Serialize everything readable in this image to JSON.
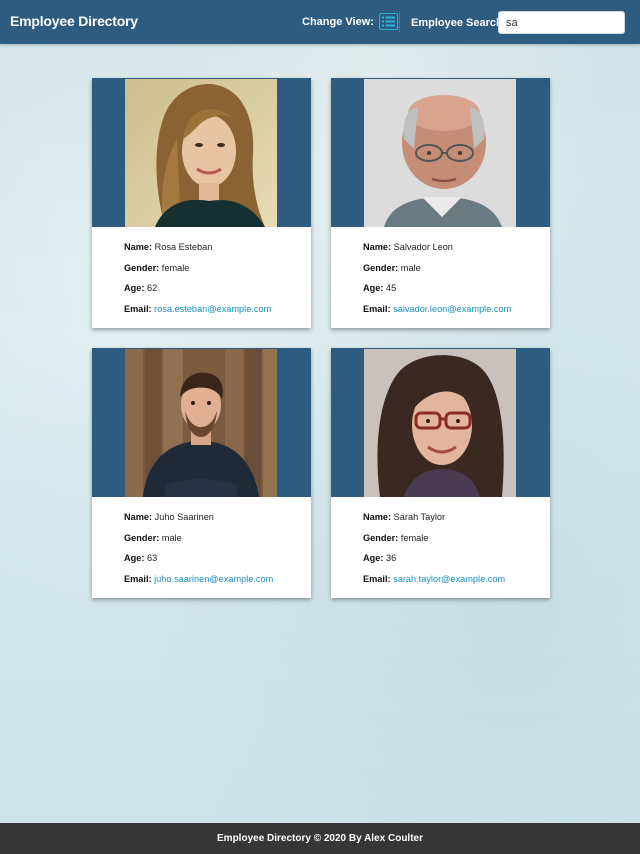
{
  "header": {
    "brand": "Employee Directory",
    "change_view_label": "Change View:",
    "view_icon": "list-view-icon",
    "search_label": "Employee Search:",
    "search_value": "sa"
  },
  "labels": {
    "name": "Name:",
    "gender": "Gender:",
    "age": "Age:",
    "email": "Email:"
  },
  "employees": [
    {
      "name": "Rosa Esteban",
      "gender": "female",
      "age": "62",
      "email": "rosa.esteban@example.com"
    },
    {
      "name": "Salvador Leon",
      "gender": "male",
      "age": "45",
      "email": "salvador.leon@example.com"
    },
    {
      "name": "Juho Saarinen",
      "gender": "male",
      "age": "63",
      "email": "juho.saarinen@example.com"
    },
    {
      "name": "Sarah Taylor",
      "gender": "female",
      "age": "36",
      "email": "sarah.taylor@example.com"
    }
  ],
  "footer": {
    "text": "Employee Directory © 2020 By Alex Coulter"
  },
  "colors": {
    "header_bg": "#2e5b80",
    "footer_bg": "#363636",
    "link": "#1a8fc0",
    "view_icon": "#2bb3d6"
  }
}
